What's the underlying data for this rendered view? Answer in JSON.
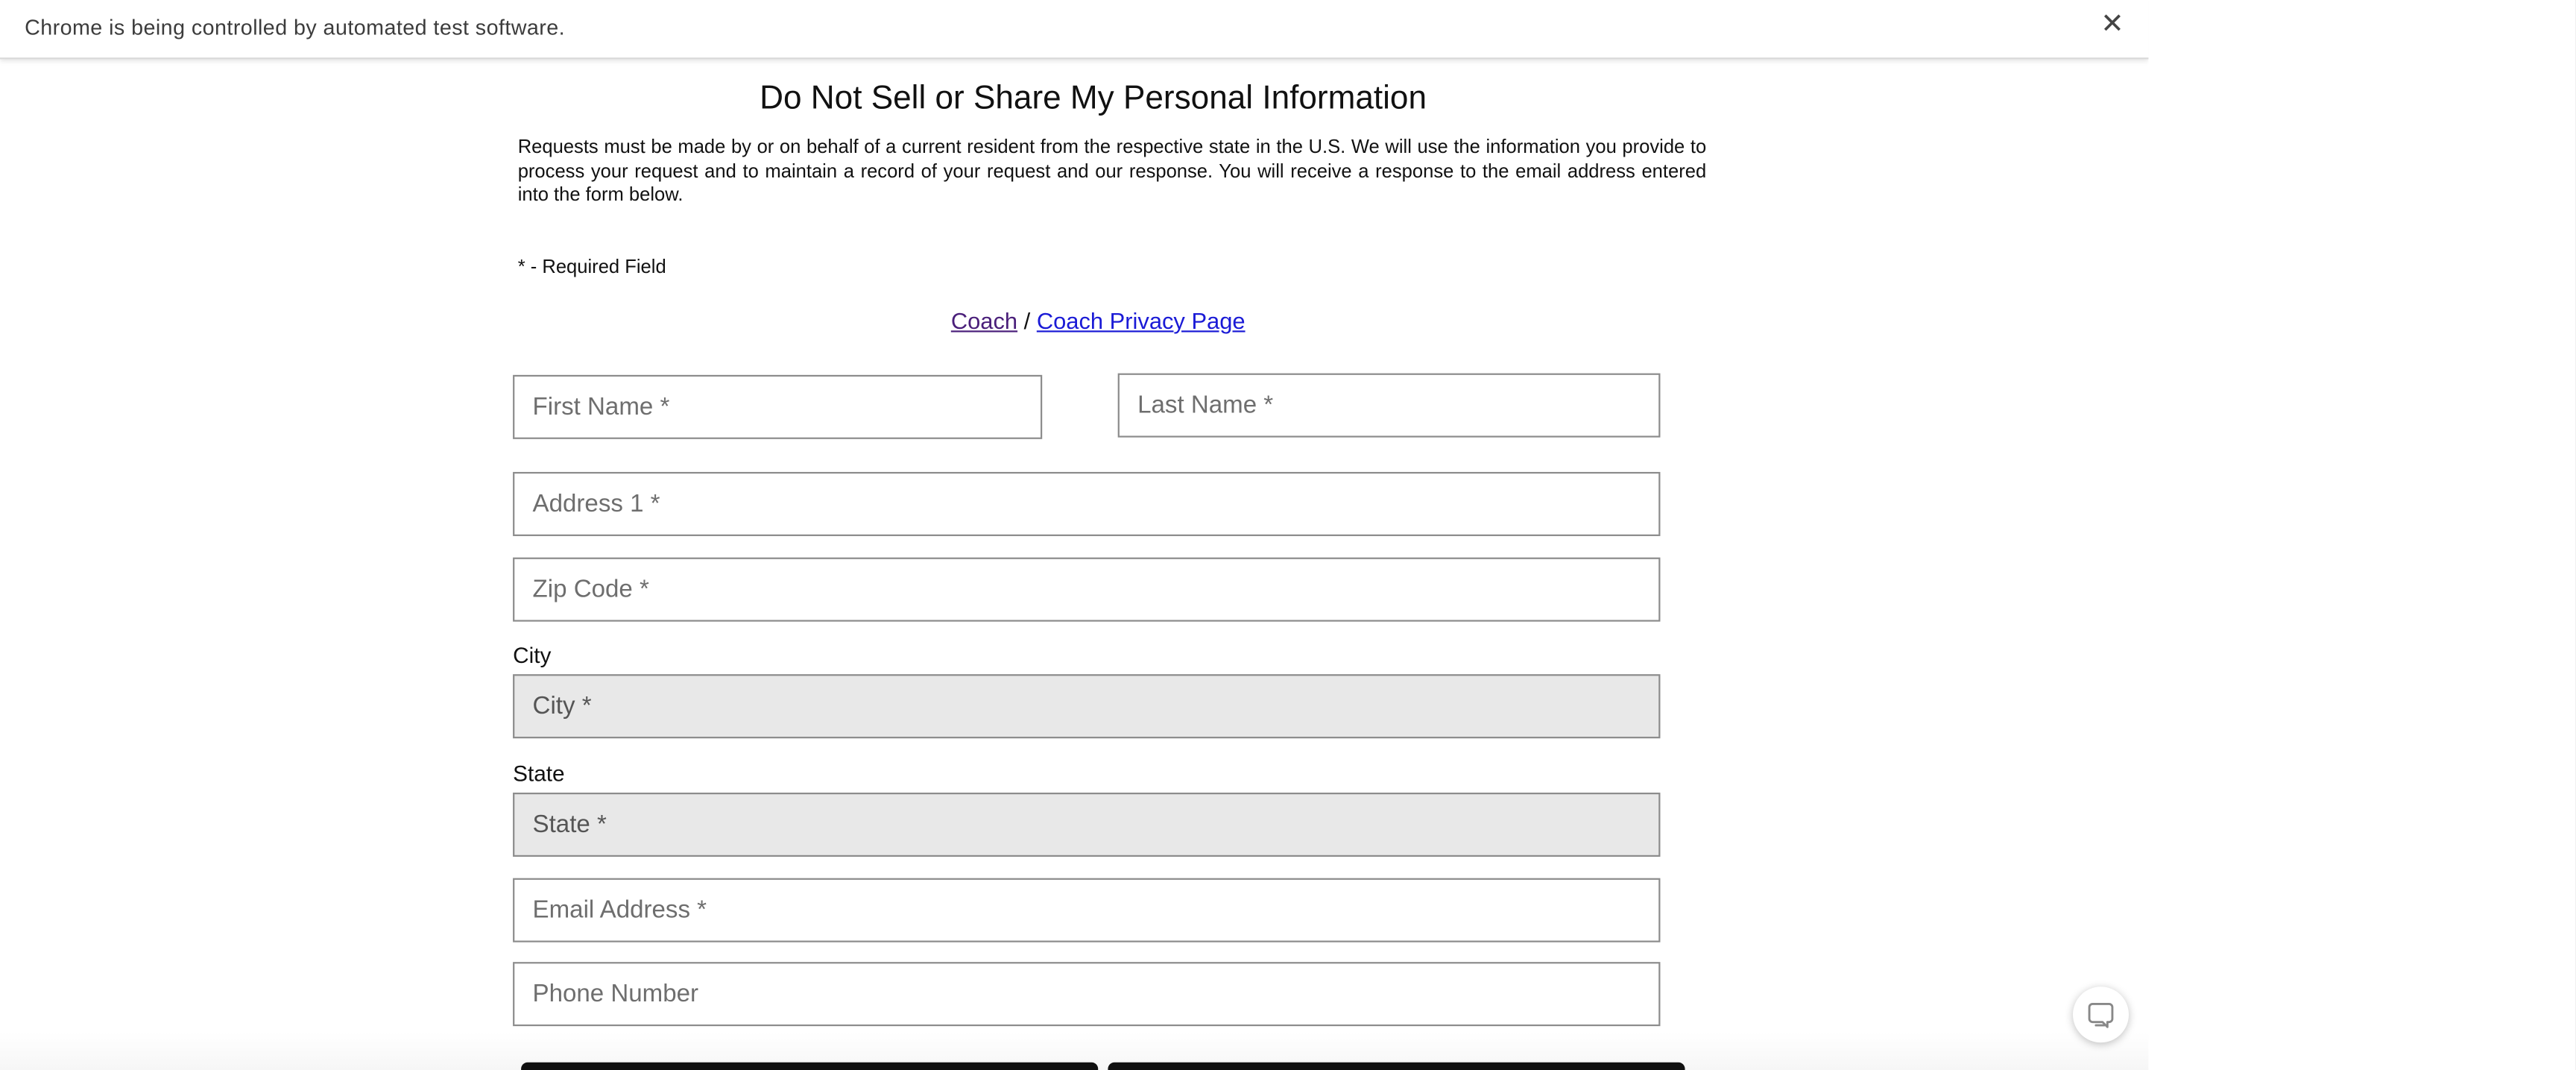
{
  "infobar": {
    "message": "Chrome is being controlled by automated test software.",
    "close_glyph": "✕"
  },
  "page": {
    "title": "Do Not Sell or Share My Personal Information",
    "intro": "Requests must be made by or on behalf of a current resident from the respective state in the U.S. We will use the information you provide to process your request and to maintain a record of your request and our response. You will receive a response to the email address entered into the form below.",
    "required_note": "* - Required Field",
    "brand_link": "Coach",
    "separator": "/",
    "privacy_link": "Coach Privacy Page"
  },
  "form": {
    "first_name_placeholder": "First Name *",
    "last_name_placeholder": "Last Name *",
    "address1_placeholder": "Address 1 *",
    "zip_placeholder": "Zip Code *",
    "city_label": "City",
    "city_placeholder": "City *",
    "state_label": "State",
    "state_placeholder": "State *",
    "email_placeholder": "Email Address *",
    "phone_placeholder": "Phone Number"
  },
  "icons": {
    "infobar_close": "close-icon",
    "chat": "chat-bubble-icon"
  },
  "colors": {
    "brand_link": "#4a1f7a",
    "privacy_link": "#1a1ad6",
    "readonly_field": "#e8e8e8",
    "button": "#111111"
  }
}
